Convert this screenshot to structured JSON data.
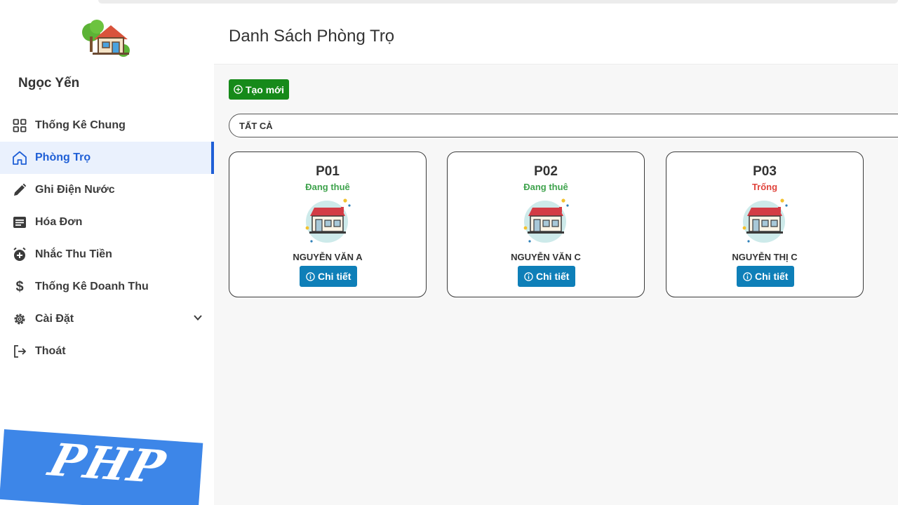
{
  "sidebar": {
    "user_name": "Ngọc Yến",
    "items": [
      {
        "label": "Thống Kê Chung",
        "icon": "grid-icon"
      },
      {
        "label": "Phòng Trọ",
        "icon": "home-icon",
        "active": true
      },
      {
        "label": "Ghi Điện Nước",
        "icon": "pencil-icon"
      },
      {
        "label": "Hóa Đơn",
        "icon": "receipt-icon"
      },
      {
        "label": "Nhắc Thu Tiền",
        "icon": "alarm-icon"
      },
      {
        "label": "Thống Kê Doanh Thu",
        "icon": "dollar-icon"
      },
      {
        "label": "Cài Đặt",
        "icon": "gear-icon"
      },
      {
        "label": "Thoát",
        "icon": "logout-icon"
      }
    ]
  },
  "header": {
    "title": "Danh Sách Phòng Trọ"
  },
  "toolbar": {
    "create_label": "Tạo mới"
  },
  "filter": {
    "selected": "TẤT CẢ"
  },
  "rooms": [
    {
      "name": "P01",
      "status": "Đang thuê",
      "tenant": "NGUYỄN VĂN A",
      "detail_label": "Chi tiết"
    },
    {
      "name": "P02",
      "status": "Đang thuê",
      "tenant": "NGUYỄN VĂN C",
      "detail_label": "Chi tiết"
    },
    {
      "name": "P03",
      "status": "Trống",
      "tenant": "NGUYỄN THỊ C",
      "detail_label": "Chi tiết"
    }
  ],
  "banner": {
    "text": "PHP"
  },
  "colors": {
    "accent": "#1f5fd6",
    "create_button": "#168a1a",
    "detail_button": "#0e7fb8",
    "status_rented": "#3fa34d",
    "status_vacant": "#e0443c",
    "banner": "#3d86e8"
  }
}
